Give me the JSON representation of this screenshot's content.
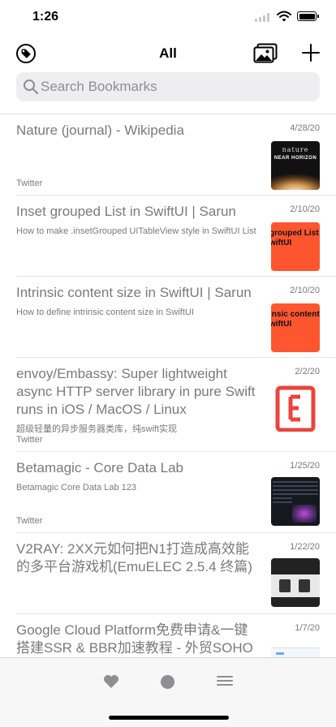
{
  "status_bar": {
    "time": "1:26"
  },
  "nav": {
    "title": "All"
  },
  "search": {
    "placeholder": "Search Bookmarks"
  },
  "bookmarks": [
    {
      "title": "Nature (journal) - Wikipedia",
      "description": "",
      "source": "Twitter",
      "date": "4/28/20",
      "thumbnail": {
        "kind": "nature",
        "line1": "nature",
        "line2": "NEAR HORIZON"
      }
    },
    {
      "title": "Inset grouped List in SwiftUI | Sarun",
      "description": "How to make .insetGrouped UITableView style in SwiftUI List",
      "source": "",
      "date": "2/10/20",
      "thumbnail": {
        "kind": "orange",
        "text": "grouped List in\nwiftUI"
      }
    },
    {
      "title": "Intrinsic content size in SwiftUI | Sarun",
      "description": "How to define intrinsic content size in SwiftUI",
      "source": "",
      "date": "2/10/20",
      "thumbnail": {
        "kind": "orange",
        "text": "insic content siz\nwiftUI"
      }
    },
    {
      "title": "envoy/Embassy: Super lightweight async HTTP server library in pure Swift runs in iOS / MacOS / Linux",
      "description": "超级轻量的异步服务器类库，纯swift实现",
      "source": "Twitter",
      "date": "2/2/20",
      "thumbnail": {
        "kind": "embassy",
        "accent": "#e8453c"
      }
    },
    {
      "title": "Betamagic - Core Data Lab",
      "description": "Betamagic Core Data Lab 123",
      "source": "Twitter",
      "date": "1/25/20",
      "thumbnail": {
        "kind": "betamagic"
      }
    },
    {
      "title": "V2RAY: 2XX元如何把N1打造成高效能的多平台游戏机(EmuELEC 2.5.4 终篇)",
      "description": "",
      "source": "",
      "date": "1/22/20",
      "thumbnail": {
        "kind": "v2ray"
      }
    },
    {
      "title": "Google Cloud Platform免费申请&一键搭建SSR & BBR加速教程 - 外贸SOHO",
      "description": "",
      "source": "",
      "date": "1/7/20",
      "thumbnail": {
        "kind": "gcp"
      }
    }
  ],
  "icons": {
    "tag": "tag-icon",
    "photos": "photo-gallery-icon",
    "add": "plus-icon",
    "search": "magnifying-glass-icon",
    "favorites": "heart-icon",
    "unread": "circle-icon",
    "menu": "hamburger-menu-icon"
  },
  "colors": {
    "text_secondary": "#7a7a7a",
    "thumb_orange": "#ff5630",
    "embassy_red": "#e8453c",
    "tab_icon": "#8e8e93"
  }
}
